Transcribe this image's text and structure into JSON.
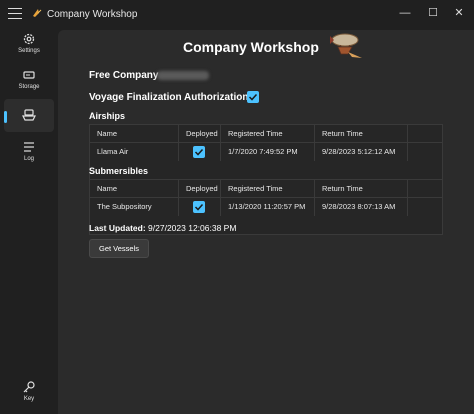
{
  "window": {
    "title": "Company Workshop",
    "controls": {
      "minimize": "—",
      "maximize": "☐",
      "close": "✕"
    }
  },
  "sidebar": {
    "items": [
      {
        "label": "Settings",
        "icon": "gear-icon"
      },
      {
        "label": "Storage",
        "icon": "storage-icon"
      },
      {
        "label": "",
        "icon": "ship-icon"
      },
      {
        "label": "Log",
        "icon": "list-icon"
      },
      {
        "label": "Key",
        "icon": "key-icon"
      }
    ],
    "active_index": 2,
    "accent": "#4cc2ff"
  },
  "main": {
    "title": "Company Workshop",
    "free_company_label": "Free Company",
    "voyage_label": "Voyage Finalization Authorization",
    "voyage_checked": true,
    "airships": {
      "heading": "Airships",
      "columns": [
        "Name",
        "Deployed",
        "Registered Time",
        "Return Time"
      ],
      "rows": [
        {
          "name": "Llama Air",
          "deployed": true,
          "registered": "1/7/2020 7:49:52 PM",
          "return": "9/28/2023 5:12:12 AM"
        }
      ]
    },
    "submersibles": {
      "heading": "Submersibles",
      "columns": [
        "Name",
        "Deployed",
        "Registered Time",
        "Return Time"
      ],
      "rows": [
        {
          "name": "The Subpository",
          "deployed": true,
          "registered": "1/13/2020 11:20:57 PM",
          "return": "9/28/2023 8:07:13 AM"
        }
      ]
    },
    "last_updated_label": "Last Updated:",
    "last_updated_value": "9/27/2023 12:06:38 PM",
    "get_vessels_label": "Get Vessels"
  }
}
